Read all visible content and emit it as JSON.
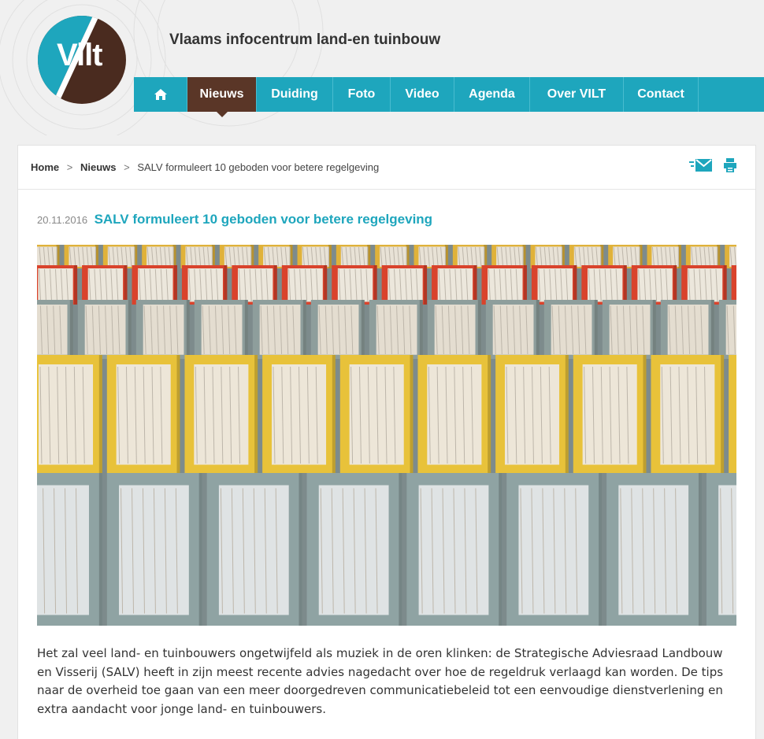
{
  "header": {
    "logo_text": "Vilt",
    "site_title": "Vlaams infocentrum land-en tuinbouw"
  },
  "nav": {
    "items": [
      {
        "label": "Nieuws"
      },
      {
        "label": "Duiding"
      },
      {
        "label": "Foto"
      },
      {
        "label": "Video"
      },
      {
        "label": "Agenda"
      },
      {
        "label": "Over VILT"
      },
      {
        "label": "Contact"
      }
    ],
    "active": "Nieuws"
  },
  "breadcrumb": {
    "home": "Home",
    "section": "Nieuws",
    "current": "SALV formuleert 10 geboden voor betere regelgeving",
    "separator": ">"
  },
  "tools": {
    "mail_icon": "mail-icon",
    "print_icon": "print-icon"
  },
  "article": {
    "date": "20.11.2016",
    "title": "SALV formuleert 10 geboden voor betere regelgeving",
    "body": "Het zal veel land- en tuinbouwers ongetwijfeld als muziek in de oren klinken: de Strategische Adviesraad Landbouw en Visserij (SALV) heeft in zijn meest recente advies nagedacht over hoe de regeldruk verlaagd kan worden. De tips naar de overheid toe gaan van een meer doorgedreven communicatiebeleid tot een eenvoudige dienstverlening en extra aandacht voor jonge land- en tuinbouwers."
  },
  "colors": {
    "accent": "#1ea6bd",
    "brand_brown": "#5a3627",
    "logo_brown": "#4a2b1f"
  }
}
